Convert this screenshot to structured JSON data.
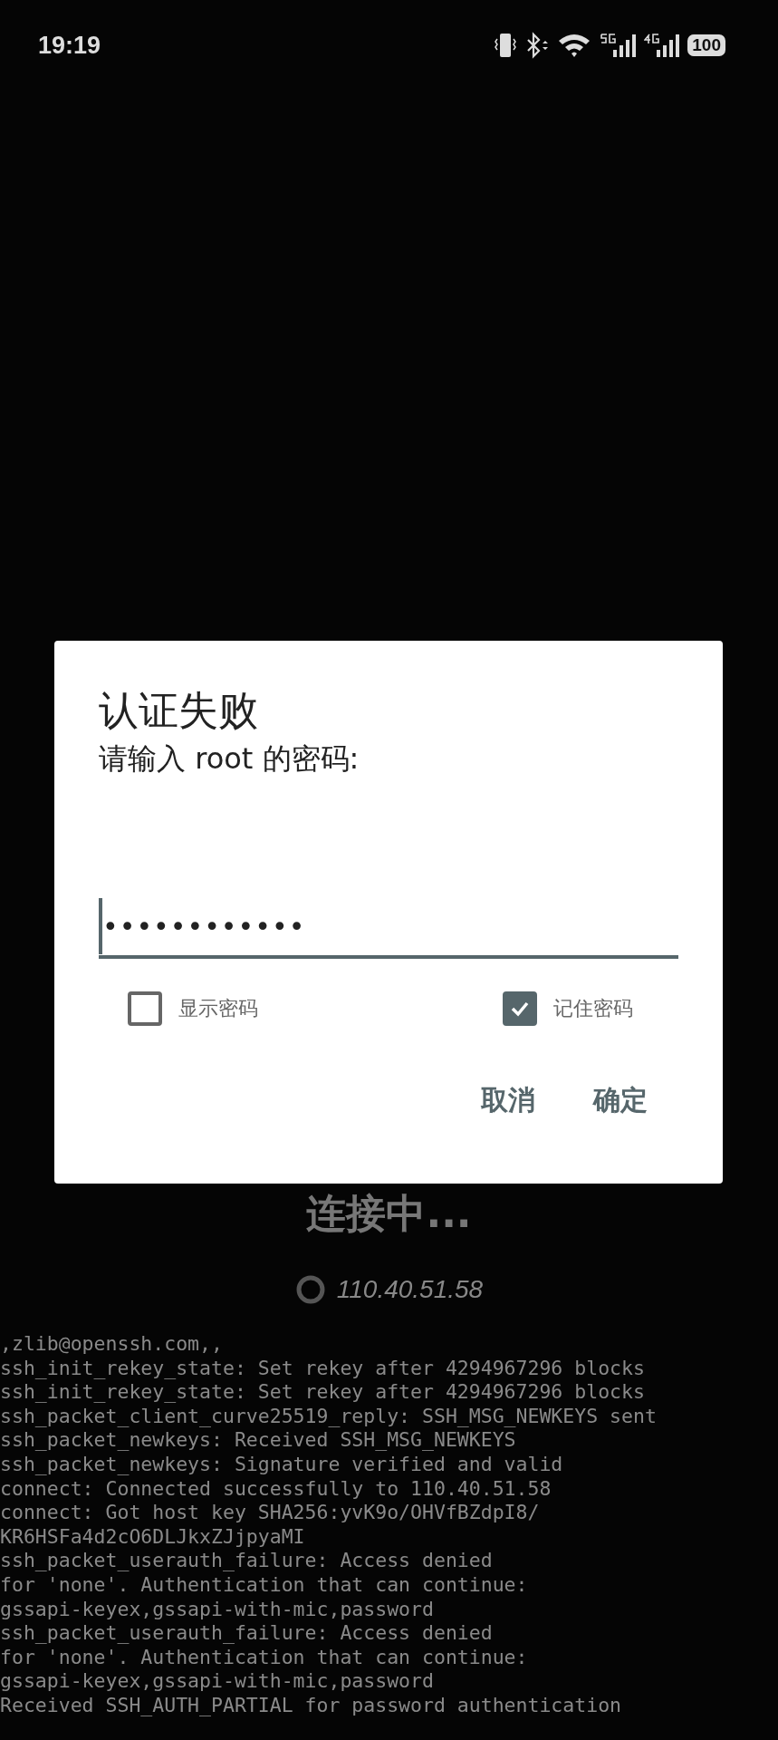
{
  "status_bar": {
    "time": "19:19",
    "battery": "100"
  },
  "background": {
    "connecting": "连接中...",
    "host": "110.40.51.58"
  },
  "log": [
    ",zlib@openssh.com,,",
    "ssh_init_rekey_state: Set rekey after 4294967296 blocks",
    "ssh_init_rekey_state: Set rekey after 4294967296 blocks",
    "ssh_packet_client_curve25519_reply: SSH_MSG_NEWKEYS sent",
    "ssh_packet_newkeys: Received SSH_MSG_NEWKEYS",
    "ssh_packet_newkeys: Signature verified and valid",
    "connect: Connected successfully to 110.40.51.58",
    "connect: Got host key SHA256:yvK9o/OHVfBZdpI8/",
    "KR6HSFa4d2cO6DLJkxZJjpyaMI",
    "ssh_packet_userauth_failure: Access denied",
    "for 'none'. Authentication that can continue:",
    "gssapi-keyex,gssapi-with-mic,password",
    "ssh_packet_userauth_failure: Access denied",
    "for 'none'. Authentication that can continue:",
    "gssapi-keyex,gssapi-with-mic,password",
    "Received SSH_AUTH_PARTIAL for password authentication"
  ],
  "dialog": {
    "title": "认证失败",
    "message": "请输入 root 的密码:",
    "password": "••••••••••••",
    "options": [
      {
        "label": "显示密码",
        "checked": false
      },
      {
        "label": "记住密码",
        "checked": true
      }
    ],
    "buttons": [
      "取消",
      "确定"
    ]
  }
}
